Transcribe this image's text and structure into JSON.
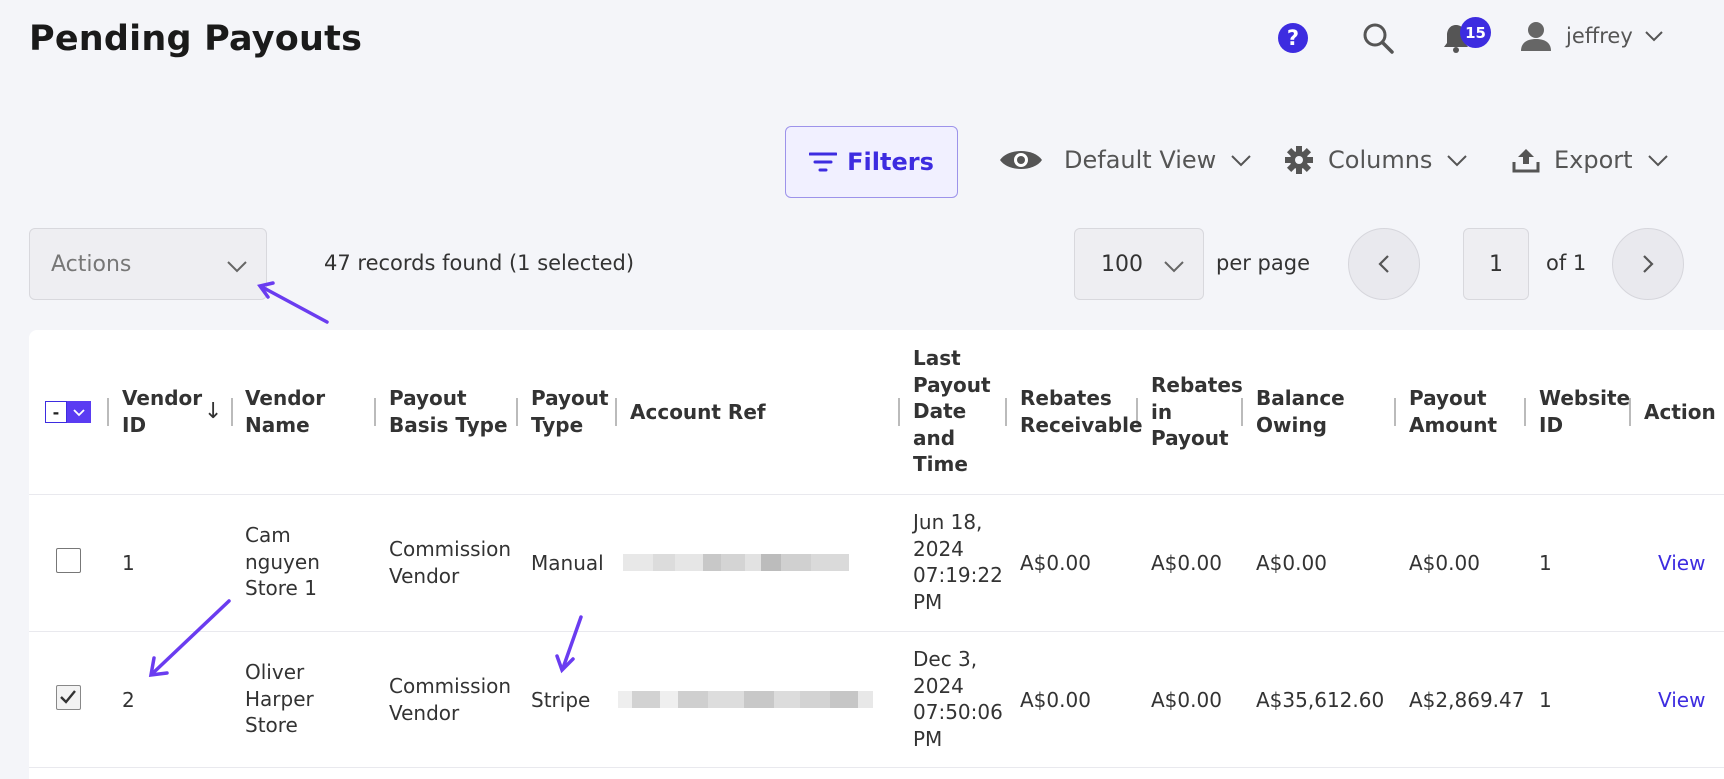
{
  "page": {
    "title": "Pending Payouts"
  },
  "header": {
    "help_glyph": "?",
    "notification_count": "15",
    "username": "jeffrey"
  },
  "toolbar": {
    "filters_label": "Filters",
    "view_label": "Default View",
    "columns_label": "Columns",
    "export_label": "Export"
  },
  "list_controls": {
    "actions_placeholder": "Actions",
    "records_text": "47 records found (1 selected)",
    "per_page_value": "100",
    "per_page_label": "per page",
    "current_page": "1",
    "page_of": "of 1"
  },
  "table": {
    "select_all_glyph": "-",
    "sort_glyph": "↓",
    "columns": [
      {
        "id": "vendor_id",
        "label": "Vendor ID",
        "lines": [
          "Vendor",
          "ID"
        ]
      },
      {
        "id": "vendor_name",
        "label": "Vendor Name",
        "lines": [
          "Vendor",
          "Name"
        ]
      },
      {
        "id": "payout_basis_type",
        "label": "Payout Basis Type",
        "lines": [
          "Payout",
          "Basis Type"
        ]
      },
      {
        "id": "payout_type",
        "label": "Payout Type",
        "lines": [
          "Payout",
          "Type"
        ]
      },
      {
        "id": "account_ref",
        "label": "Account Ref",
        "lines": [
          "Account Ref"
        ]
      },
      {
        "id": "last_payout",
        "label": "Last Payout Date and Time",
        "lines": [
          "Last",
          "Payout",
          "Date",
          "and",
          "Time"
        ]
      },
      {
        "id": "rebates_receivable",
        "label": "Rebates Receivable",
        "lines": [
          "Rebates",
          "Receivable"
        ]
      },
      {
        "id": "rebates_in_payout",
        "label": "Rebates in Payout",
        "lines": [
          "Rebates",
          "in",
          "Payout"
        ]
      },
      {
        "id": "balance_owing",
        "label": "Balance Owing",
        "lines": [
          "Balance",
          "Owing"
        ]
      },
      {
        "id": "payout_amount",
        "label": "Payout Amount",
        "lines": [
          "Payout",
          "Amount"
        ]
      },
      {
        "id": "website_id",
        "label": "Website ID",
        "lines": [
          "Website",
          "ID"
        ]
      },
      {
        "id": "action",
        "label": "Action",
        "lines": [
          "Action"
        ]
      }
    ],
    "rows": [
      {
        "checked": false,
        "vendor_id": "1",
        "vendor_name_lines": [
          "Cam",
          "nguyen",
          "Store 1"
        ],
        "payout_basis_type_lines": [
          "Commission",
          "Vendor"
        ],
        "payout_type": "Manual",
        "account_ref": "",
        "last_payout_lines": [
          "Jun 18,",
          "2024",
          "07:19:22",
          "PM"
        ],
        "rebates_receivable": "A$0.00",
        "rebates_in_payout": "A$0.00",
        "balance_owing": "A$0.00",
        "payout_amount": "A$0.00",
        "website_id": "1",
        "action": "View"
      },
      {
        "checked": true,
        "vendor_id": "2",
        "vendor_name_lines": [
          "Oliver",
          "Harper",
          "Store"
        ],
        "payout_basis_type_lines": [
          "Commission",
          "Vendor"
        ],
        "payout_type": "Stripe",
        "account_ref": "",
        "last_payout_lines": [
          "Dec 3,",
          "2024",
          "07:50:06",
          "PM"
        ],
        "rebates_receivable": "A$0.00",
        "rebates_in_payout": "A$0.00",
        "balance_owing": "A$35,612.60",
        "payout_amount": "A$2,869.47",
        "website_id": "1",
        "action": "View"
      }
    ]
  },
  "colors": {
    "accent": "#3d2ce0",
    "background": "#f4f5f9",
    "annotation_arrow": "#6a3cf0"
  }
}
